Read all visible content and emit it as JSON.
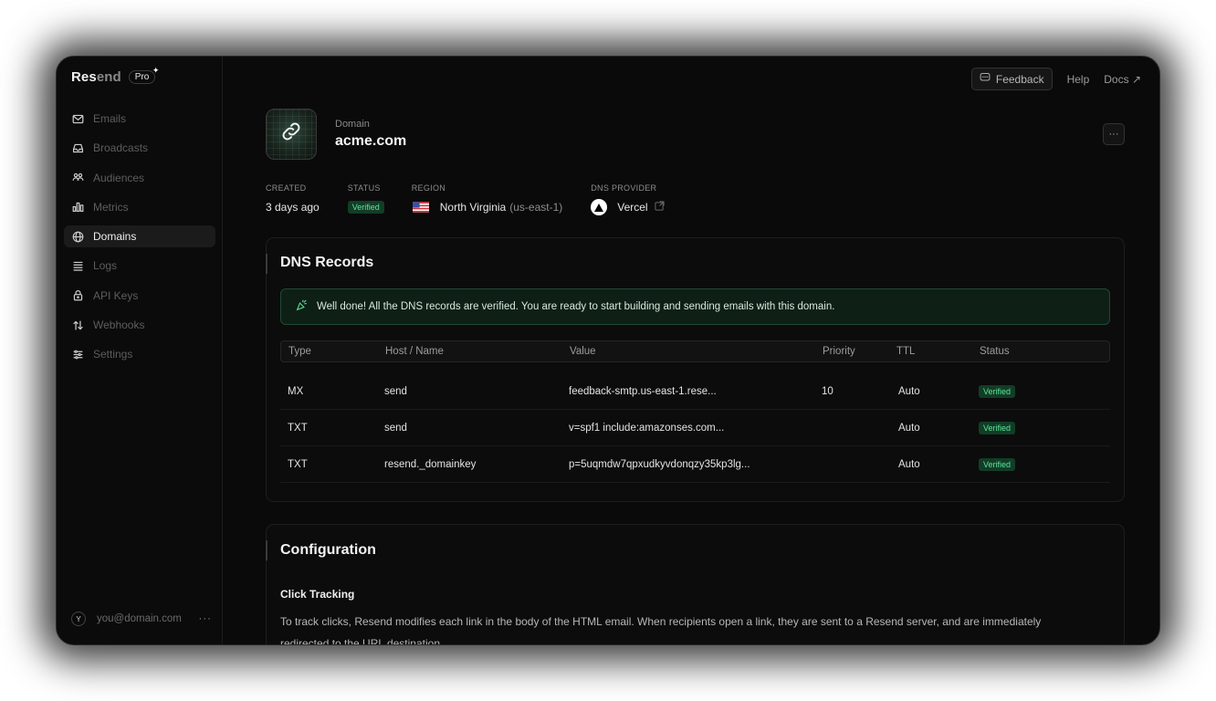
{
  "brand": {
    "name_strong": "Res",
    "name_rest": "end",
    "plan": "Pro"
  },
  "sidebar": {
    "items": [
      {
        "label": "Emails",
        "icon": "mail-icon"
      },
      {
        "label": "Broadcasts",
        "icon": "inbox-icon"
      },
      {
        "label": "Audiences",
        "icon": "users-icon"
      },
      {
        "label": "Metrics",
        "icon": "bar-chart-icon"
      },
      {
        "label": "Domains",
        "icon": "globe-icon",
        "active": true
      },
      {
        "label": "Logs",
        "icon": "list-icon"
      },
      {
        "label": "API Keys",
        "icon": "lock-icon"
      },
      {
        "label": "Webhooks",
        "icon": "arrows-icon"
      },
      {
        "label": "Settings",
        "icon": "sliders-icon"
      }
    ],
    "user": {
      "initial": "Y",
      "email": "you@domain.com",
      "more": "···"
    }
  },
  "topbar": {
    "feedback": "Feedback",
    "help": "Help",
    "docs": "Docs ↗"
  },
  "domain": {
    "label": "Domain",
    "name": "acme.com",
    "more": "···",
    "meta": {
      "created_label": "CREATED",
      "created_value": "3 days ago",
      "status_label": "STATUS",
      "status_value": "Verified",
      "region_label": "REGION",
      "region_value": "North Virginia",
      "region_code": "(us-east-1)",
      "dns_label": "DNS PROVIDER",
      "dns_value": "Vercel"
    }
  },
  "dns": {
    "title": "DNS Records",
    "banner": "Well done! All the DNS records are verified. You are ready to start building and sending emails with this domain.",
    "columns": [
      "Type",
      "Host / Name",
      "Value",
      "Priority",
      "TTL",
      "Status"
    ],
    "rows": [
      {
        "type": "MX",
        "host": "send",
        "value": "feedback-smtp.us-east-1.rese...",
        "priority": "10",
        "ttl": "Auto",
        "status": "Verified"
      },
      {
        "type": "TXT",
        "host": "send",
        "value": "v=spf1 include:amazonses.com...",
        "priority": "",
        "ttl": "Auto",
        "status": "Verified"
      },
      {
        "type": "TXT",
        "host": "resend._domainkey",
        "value": "p=5uqmdw7qpxudkyvdonqzy35kp3lg...",
        "priority": "",
        "ttl": "Auto",
        "status": "Verified"
      }
    ]
  },
  "config": {
    "title": "Configuration",
    "subtitle": "Click Tracking",
    "description": "To track clicks, Resend modifies each link in the body of the HTML email. When recipients open a link, they are sent to a Resend server, and are immediately redirected to the URL destination."
  },
  "colors": {
    "accent_green": "#5fe39a",
    "background": "#0a0a0a"
  }
}
